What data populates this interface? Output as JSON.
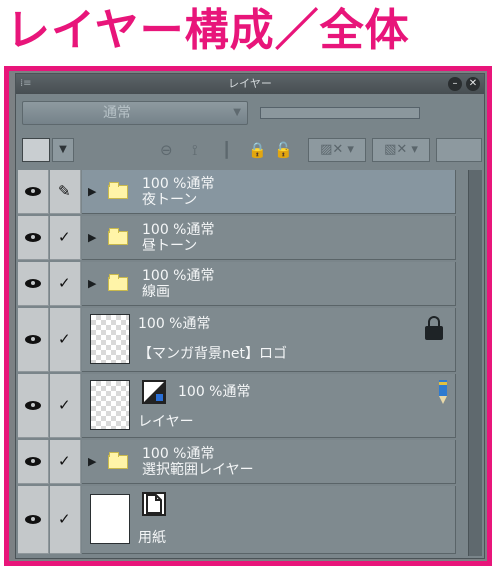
{
  "heading": "レイヤー構成／全体",
  "panel": {
    "title": "レイヤー",
    "blend_mode": "通常",
    "grip_icon": "grip-icon",
    "minimize_icon": "minimize-icon",
    "close_icon": "close-icon",
    "close_glyph": "✕",
    "minimize_glyph": "–"
  },
  "toolbar": {
    "icons": [
      "layer-clip-icon",
      "reference-icon",
      "draft-pen-icon",
      "lock-icon",
      "alpha-lock-icon",
      "delete-mask-icon",
      "mask-icon"
    ]
  },
  "layers": [
    {
      "name": "夜トーン",
      "opacity_mode": "100 %通常",
      "kind": "folder",
      "selected": true,
      "edit_mark": "pen"
    },
    {
      "name": "昼トーン",
      "opacity_mode": "100 %通常",
      "kind": "folder",
      "selected": false,
      "edit_mark": "check"
    },
    {
      "name": "線画",
      "opacity_mode": "100 %通常",
      "kind": "folder",
      "selected": false,
      "edit_mark": "check"
    },
    {
      "name": "【マンガ背景net】ロゴ",
      "opacity_mode": "100 %通常",
      "kind": "raster",
      "selected": false,
      "edit_mark": "check",
      "locked": true
    },
    {
      "name": "レイヤー",
      "opacity_mode": "100 %通常",
      "kind": "raster-with-mask",
      "selected": false,
      "edit_mark": "check",
      "drawing": true
    },
    {
      "name": "選択範囲レイヤー",
      "opacity_mode": "100 %通常",
      "kind": "folder",
      "selected": false,
      "edit_mark": "check"
    },
    {
      "name": "用紙",
      "opacity_mode": "",
      "kind": "paper",
      "selected": false,
      "edit_mark": "check"
    }
  ],
  "colors": {
    "accent": "#e8157a",
    "panel_bg": "#7a858a",
    "folder": "#fff4a8"
  }
}
